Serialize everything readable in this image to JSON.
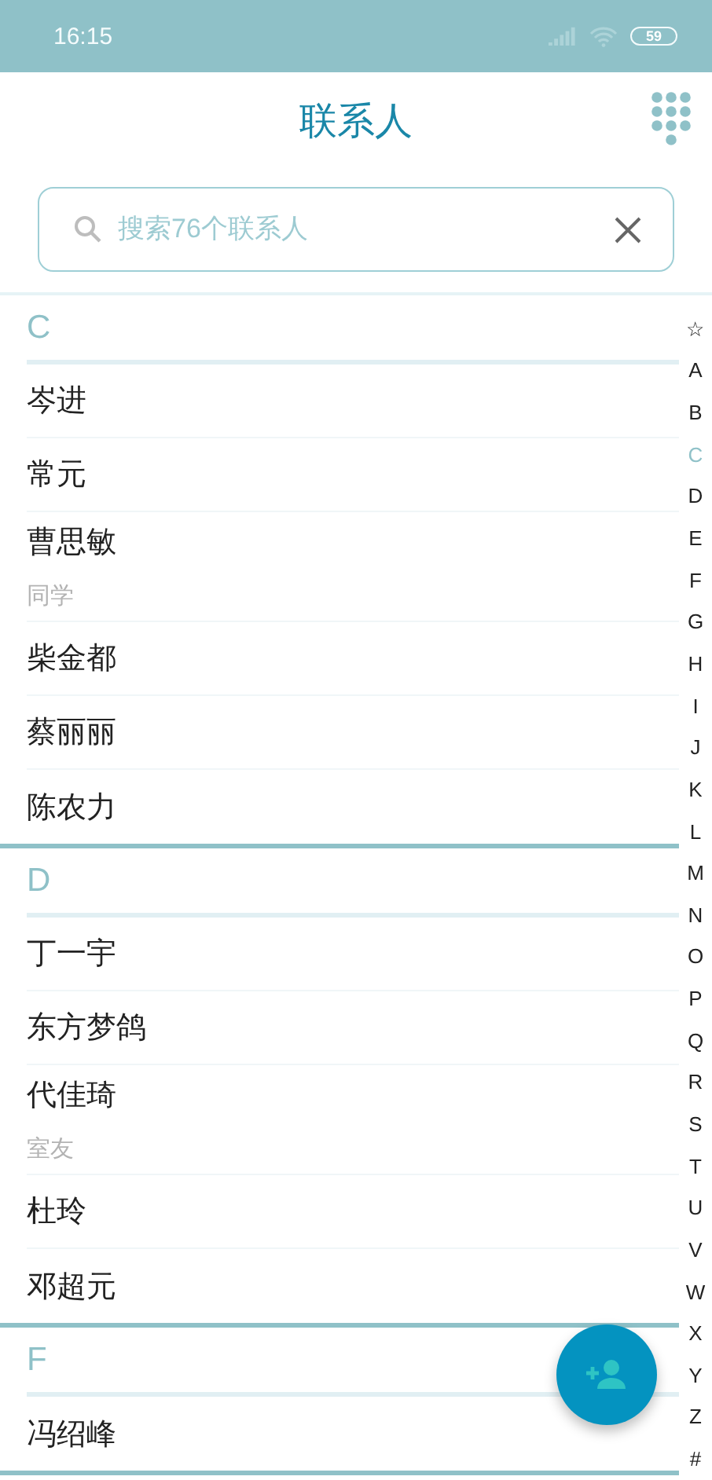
{
  "status_bar": {
    "time": "16:15",
    "battery": "59"
  },
  "header": {
    "title": "联系人"
  },
  "search": {
    "placeholder": "搜索76个联系人"
  },
  "sections": [
    {
      "letter": "C",
      "contacts": [
        {
          "name": "岑进"
        },
        {
          "name": "常元"
        },
        {
          "name": "曹思敏",
          "note": "同学"
        },
        {
          "name": "柴金都"
        },
        {
          "name": "蔡丽丽"
        },
        {
          "name": "陈农力"
        }
      ]
    },
    {
      "letter": "D",
      "contacts": [
        {
          "name": "丁一宇"
        },
        {
          "name": "东方梦鸽"
        },
        {
          "name": "代佳琦",
          "note": "室友"
        },
        {
          "name": "杜玲"
        },
        {
          "name": "邓超元"
        }
      ]
    },
    {
      "letter": "F",
      "contacts": [
        {
          "name": "冯绍峰"
        }
      ]
    }
  ],
  "index": [
    {
      "label": "☆",
      "selected": false
    },
    {
      "label": "A",
      "selected": false
    },
    {
      "label": "B",
      "selected": false
    },
    {
      "label": "C",
      "selected": true
    },
    {
      "label": "D",
      "selected": false
    },
    {
      "label": "E",
      "selected": false
    },
    {
      "label": "F",
      "selected": false
    },
    {
      "label": "G",
      "selected": false
    },
    {
      "label": "H",
      "selected": false
    },
    {
      "label": "I",
      "selected": false
    },
    {
      "label": "J",
      "selected": false
    },
    {
      "label": "K",
      "selected": false
    },
    {
      "label": "L",
      "selected": false
    },
    {
      "label": "M",
      "selected": false
    },
    {
      "label": "N",
      "selected": false
    },
    {
      "label": "O",
      "selected": false
    },
    {
      "label": "P",
      "selected": false
    },
    {
      "label": "Q",
      "selected": false
    },
    {
      "label": "R",
      "selected": false
    },
    {
      "label": "S",
      "selected": false
    },
    {
      "label": "T",
      "selected": false
    },
    {
      "label": "U",
      "selected": false
    },
    {
      "label": "V",
      "selected": false
    },
    {
      "label": "W",
      "selected": false
    },
    {
      "label": "X",
      "selected": false
    },
    {
      "label": "Y",
      "selected": false
    },
    {
      "label": "Z",
      "selected": false
    },
    {
      "label": "#",
      "selected": false
    }
  ]
}
